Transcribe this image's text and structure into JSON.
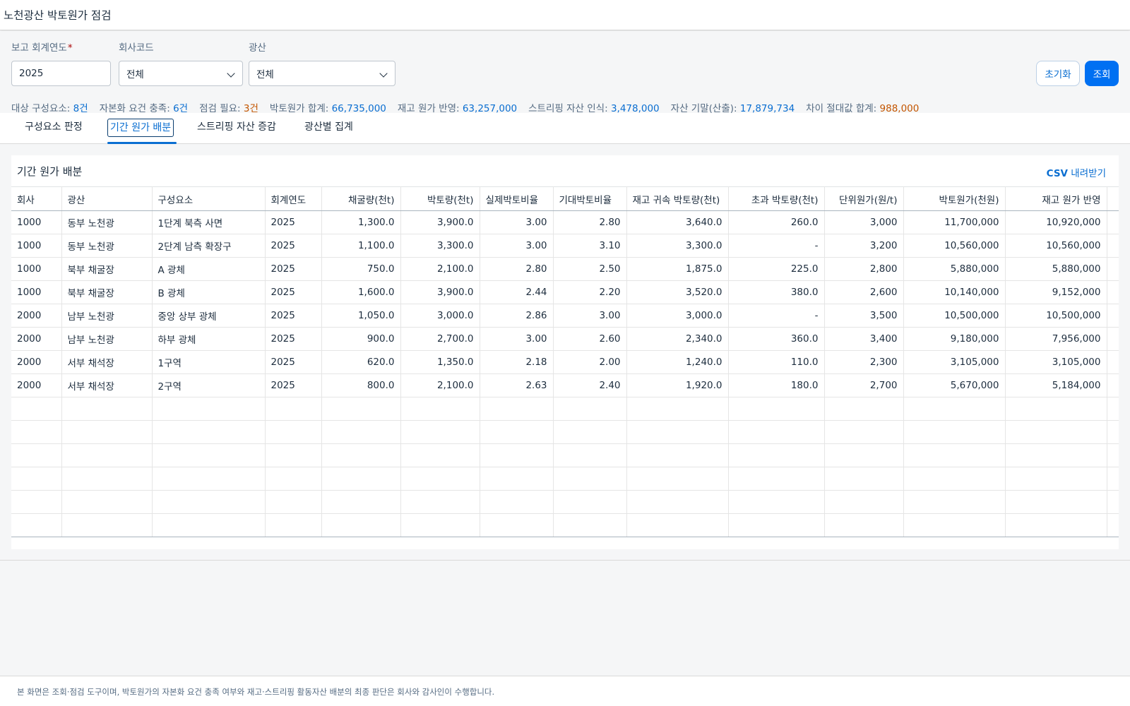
{
  "header": {
    "title": "노천광산 박토원가 점검"
  },
  "filters": {
    "year": {
      "label": "보고 회계연도",
      "required_mark": "*",
      "value": "2025"
    },
    "company": {
      "label": "회사코드",
      "value": "전체"
    },
    "mine": {
      "label": "광산",
      "value": "전체"
    }
  },
  "actions": {
    "reset_label": "초기화",
    "search_label": "조회"
  },
  "summary": [
    {
      "label": "대상 구성요소:",
      "value": "8건",
      "tone": "v"
    },
    {
      "label": "자본화 요건 충족:",
      "value": "6건",
      "tone": "v"
    },
    {
      "label": "점검 필요:",
      "value": "3건",
      "tone": "warn"
    },
    {
      "label": "박토원가 합계:",
      "value": "66,735,000",
      "tone": "v"
    },
    {
      "label": "재고 원가 반영:",
      "value": "63,257,000",
      "tone": "v"
    },
    {
      "label": "스트리핑 자산 인식:",
      "value": "3,478,000",
      "tone": "v"
    },
    {
      "label": "자산 기말(산출):",
      "value": "17,879,734",
      "tone": "v"
    },
    {
      "label": "차이 절대값 합계:",
      "value": "988,000",
      "tone": "warn"
    }
  ],
  "tabs": [
    {
      "label": "구성요소 판정",
      "active": false
    },
    {
      "label": "기간 원가 배분",
      "active": true
    },
    {
      "label": "스트리핑 자산 증감",
      "active": false
    },
    {
      "label": "광산별 집계",
      "active": false
    }
  ],
  "card": {
    "title": "기간 원가 배분",
    "csv_label_strong": "CSV",
    "csv_label_rest": " 내려받기"
  },
  "table": {
    "columns": [
      "회사",
      "광산",
      "구성요소",
      "회계연도",
      "채굴량(천t)",
      "박토량(천t)",
      "실제박토비율",
      "기대박토비율",
      "재고 귀속 박토량(천t)",
      "초과 박토량(천t)",
      "단위원가(원/t)",
      "박토원가(천원)",
      "재고 원가 반영"
    ],
    "rows": [
      [
        "1000",
        "동부 노천광",
        "1단계 북측 사면",
        "2025",
        "1,300.0",
        "3,900.0",
        "3.00",
        "2.80",
        "3,640.0",
        "260.0",
        "3,000",
        "11,700,000",
        "10,920,000"
      ],
      [
        "1000",
        "동부 노천광",
        "2단계 남측 확장구",
        "2025",
        "1,100.0",
        "3,300.0",
        "3.00",
        "3.10",
        "3,300.0",
        "-",
        "3,200",
        "10,560,000",
        "10,560,000"
      ],
      [
        "1000",
        "북부 채굴장",
        "A 광체",
        "2025",
        "750.0",
        "2,100.0",
        "2.80",
        "2.50",
        "1,875.0",
        "225.0",
        "2,800",
        "5,880,000",
        "5,880,000"
      ],
      [
        "1000",
        "북부 채굴장",
        "B 광체",
        "2025",
        "1,600.0",
        "3,900.0",
        "2.44",
        "2.20",
        "3,520.0",
        "380.0",
        "2,600",
        "10,140,000",
        "9,152,000"
      ],
      [
        "2000",
        "남부 노천광",
        "중앙 상부 광체",
        "2025",
        "1,050.0",
        "3,000.0",
        "2.86",
        "3.00",
        "3,000.0",
        "-",
        "3,500",
        "10,500,000",
        "10,500,000"
      ],
      [
        "2000",
        "남부 노천광",
        "하부 광체",
        "2025",
        "900.0",
        "2,700.0",
        "3.00",
        "2.60",
        "2,340.0",
        "360.0",
        "3,400",
        "9,180,000",
        "7,956,000"
      ],
      [
        "2000",
        "서부 채석장",
        "1구역",
        "2025",
        "620.0",
        "1,350.0",
        "2.18",
        "2.00",
        "1,240.0",
        "110.0",
        "2,300",
        "3,105,000",
        "3,105,000"
      ],
      [
        "2000",
        "서부 채석장",
        "2구역",
        "2025",
        "800.0",
        "2,100.0",
        "2.63",
        "2.40",
        "1,920.0",
        "180.0",
        "2,700",
        "5,670,000",
        "5,184,000"
      ]
    ],
    "empty_rows": 6
  },
  "footer": {
    "text": "본 화면은 조회·점검 도구이며, 박토원가의 자본화 요건 충족 여부와 재고·스트리핑 활동자산 배분의 최종 판단은 회사와 감사인이 수행합니다."
  }
}
